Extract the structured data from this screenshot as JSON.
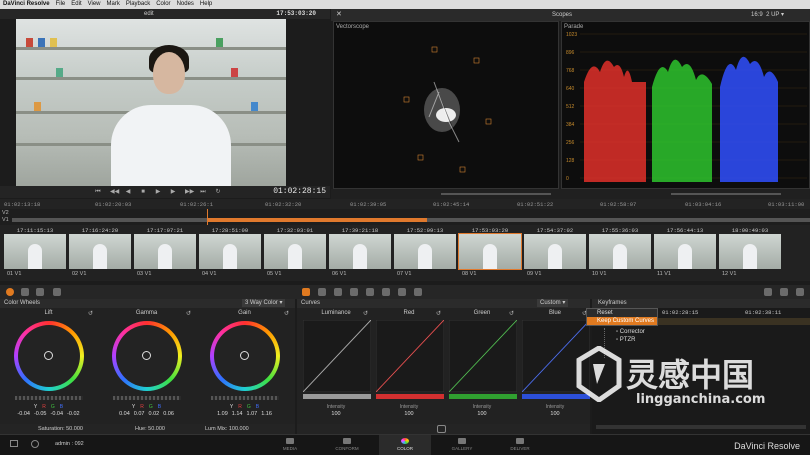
{
  "menu": {
    "app": "DaVinci Resolve",
    "items": [
      "File",
      "Edit",
      "View",
      "Mark",
      "Playback",
      "Color",
      "Nodes",
      "Help"
    ]
  },
  "viewer": {
    "mode": "edit",
    "timecode_top": "17:53:03:20",
    "timecode_bottom": "01:02:28:15"
  },
  "scopes": {
    "title": "Scopes",
    "vectorscope_label": "Vectorscope",
    "parade_label": "Parade",
    "ratio": "16:9",
    "view": "2 UP",
    "parade_ticks": [
      "1023",
      "896",
      "768",
      "640",
      "512",
      "384",
      "256",
      "128",
      "0"
    ]
  },
  "ruler": [
    "01:02:13:18",
    "01:02:20:03",
    "01:02:26:1",
    "01:02:32:20",
    "01:02:39:05",
    "01:02:45:14",
    "01:02:51:22",
    "01:02:58:07",
    "01:03:04:16",
    "01:03:11:00"
  ],
  "tracks": [
    "V2",
    "V1"
  ],
  "clips": [
    {
      "tc": "17:11:15:13",
      "label": "01 V1"
    },
    {
      "tc": "17:16:24:20",
      "label": "02 V1"
    },
    {
      "tc": "17:17:07:21",
      "label": "03 V1"
    },
    {
      "tc": "17:28:51:00",
      "label": "04 V1"
    },
    {
      "tc": "17:32:03:01",
      "label": "05 V1"
    },
    {
      "tc": "17:39:21:18",
      "label": "06 V1"
    },
    {
      "tc": "17:52:09:13",
      "label": "07 V1"
    },
    {
      "tc": "17:53:03:20",
      "label": "08 V1"
    },
    {
      "tc": "17:54:37:02",
      "label": "09 V1"
    },
    {
      "tc": "17:55:36:03",
      "label": "10 V1"
    },
    {
      "tc": "17:56:44:13",
      "label": "11 V1"
    },
    {
      "tc": "18:00:49:03",
      "label": "12 V1"
    }
  ],
  "color_wheels": {
    "title": "Color Wheels",
    "mode": "3 Way Color",
    "wheels": [
      {
        "name": "Lift",
        "values": [
          "-0.04",
          "-0.05",
          "-0.04",
          "-0.02"
        ]
      },
      {
        "name": "Gamma",
        "values": [
          "0.04",
          "0.07",
          "0.02",
          "0.06"
        ]
      },
      {
        "name": "Gain",
        "values": [
          "1.09",
          "1.14",
          "1.07",
          "1.16"
        ]
      }
    ],
    "channels": [
      "Y",
      "R",
      "G",
      "B"
    ],
    "saturation": "Saturation: 50.000",
    "hue": "Hue: 50.000",
    "lum_mix": "Lum Mix: 100.000"
  },
  "curves": {
    "title": "Curves",
    "mode": "Custom",
    "intensity_label": "Intensity",
    "channels": [
      {
        "name": "Luminance",
        "intensity": "100",
        "color": "#9a9a9a"
      },
      {
        "name": "Red",
        "intensity": "100",
        "color": "#d23030"
      },
      {
        "name": "Green",
        "intensity": "100",
        "color": "#30a030"
      },
      {
        "name": "Blue",
        "intensity": "100",
        "color": "#2c4fd8"
      }
    ]
  },
  "keyframes": {
    "title": "Keyframes",
    "menu": [
      "Reset",
      "Keep Custom Curves"
    ],
    "items": [
      "Corrector",
      "PTZR"
    ],
    "ruler": [
      "01:02:28:15",
      "01:02:38:11"
    ]
  },
  "bottom": {
    "user": "admin : 092",
    "pages": [
      "MEDIA",
      "CONFORM",
      "COLOR",
      "GALLERY",
      "DELIVER"
    ],
    "active_page": "COLOR",
    "brand": "DaVinci Resolve"
  },
  "watermark": {
    "cn": "灵感中国",
    "url": "lingganchina.com"
  }
}
